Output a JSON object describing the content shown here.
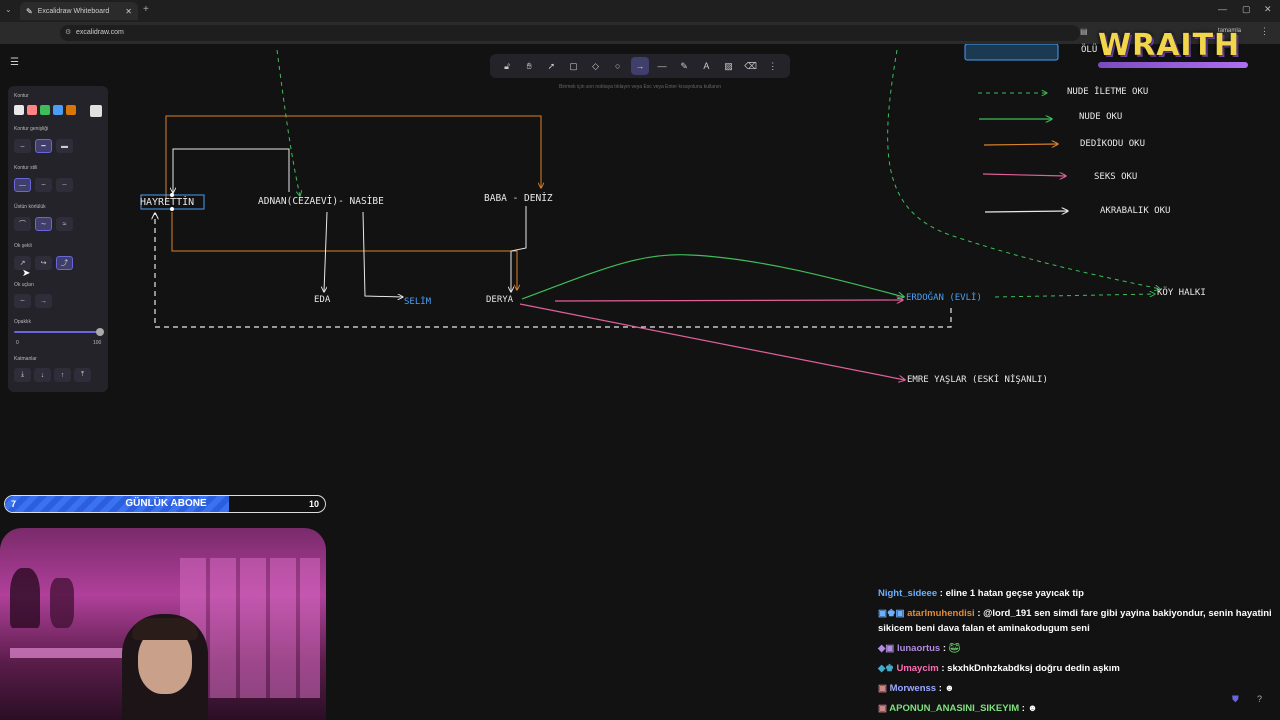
{
  "browser": {
    "tab_title": "Excalidraw Whiteboard",
    "url": "excalidraw.com",
    "extension_label": "tamamla"
  },
  "toolbar": {
    "hint": "Birimek için son noktaya tıklayın veya Esc veya Enter kısayolunu kullanın"
  },
  "panel": {
    "stroke_label": "Kontur",
    "stroke_colors": [
      "#e8e8e8",
      "#ff8383",
      "#3ebe5a",
      "#4a9ff5",
      "#d97706"
    ],
    "background_color": "#e0e0e0",
    "stroke_width_label": "Kontur genişliği",
    "stroke_style_label": "Kontur stili",
    "sloppiness_label": "Üstün körlülük",
    "arrow_type_label": "Ok şekli",
    "arrowheads_label": "Ok uçları",
    "opacity_label": "Opaklık",
    "opacity_min": "0",
    "opacity_max": "100",
    "layers_label": "Katmanlar"
  },
  "diagram": {
    "nodes": {
      "hayrettin": "HAYRETTİN",
      "adnan": "ADNAN(CEZAEVİ)- NASİBE",
      "baba": "BABA - DENİZ",
      "eda": "EDA",
      "selim": "SELİM",
      "derya": "DERYA",
      "erdogan": "ERDOĞAN (EVLİ)",
      "koy": "KÖY HALKI",
      "emre": "EMRE YAŞLAR  (ESKİ NİŞANLI)"
    },
    "legend": {
      "nude_iletme": "NUDE İLETME OKU",
      "nude": "NUDE OKU",
      "dedikodu": "DEDİKODU OKU",
      "seks": "SEKS OKU",
      "akrabalik": "AKRABALIK OKU"
    },
    "legend_partial": "ÖLÜ",
    "colors": {
      "nude": "#3ebe5a",
      "dedikodu": "#d9822b",
      "seks": "#e0609a",
      "akrabalik": "#e8e8e8",
      "selected": "#4a9ff5"
    }
  },
  "overlay": {
    "logo": "WRAITH",
    "sub_goal_title": "GÜNLÜK ABONE",
    "sub_current": "7",
    "sub_target": "10",
    "sub_progress": 0.7
  },
  "chat": [
    {
      "user": "Night_sideee",
      "color": "#6ab0ff",
      "text": ": eline 1 hatan geçse yayıcak tip"
    },
    {
      "user": "atarlmuhendisi",
      "color": "#e08a3a",
      "text": ": @lord_191 sen simdi fare gibi yayina bakiyondur, senin hayatini sikicem beni dava falan et aminakodugum seni",
      "mention": "@lord_191"
    },
    {
      "user": "lunaortus",
      "color": "#b08be0",
      "text": ":"
    },
    {
      "user": "Umaycim",
      "color": "#ff6eb4",
      "text": ": skxhkDnhzkabdksj doğru dedin aşkım"
    },
    {
      "user": "Morwenss",
      "color": "#9aa8ff",
      "text": ":"
    },
    {
      "user": "APONUN_ANASINI_SIKEYIM",
      "color": "#7fe07f",
      "text": ":"
    }
  ]
}
